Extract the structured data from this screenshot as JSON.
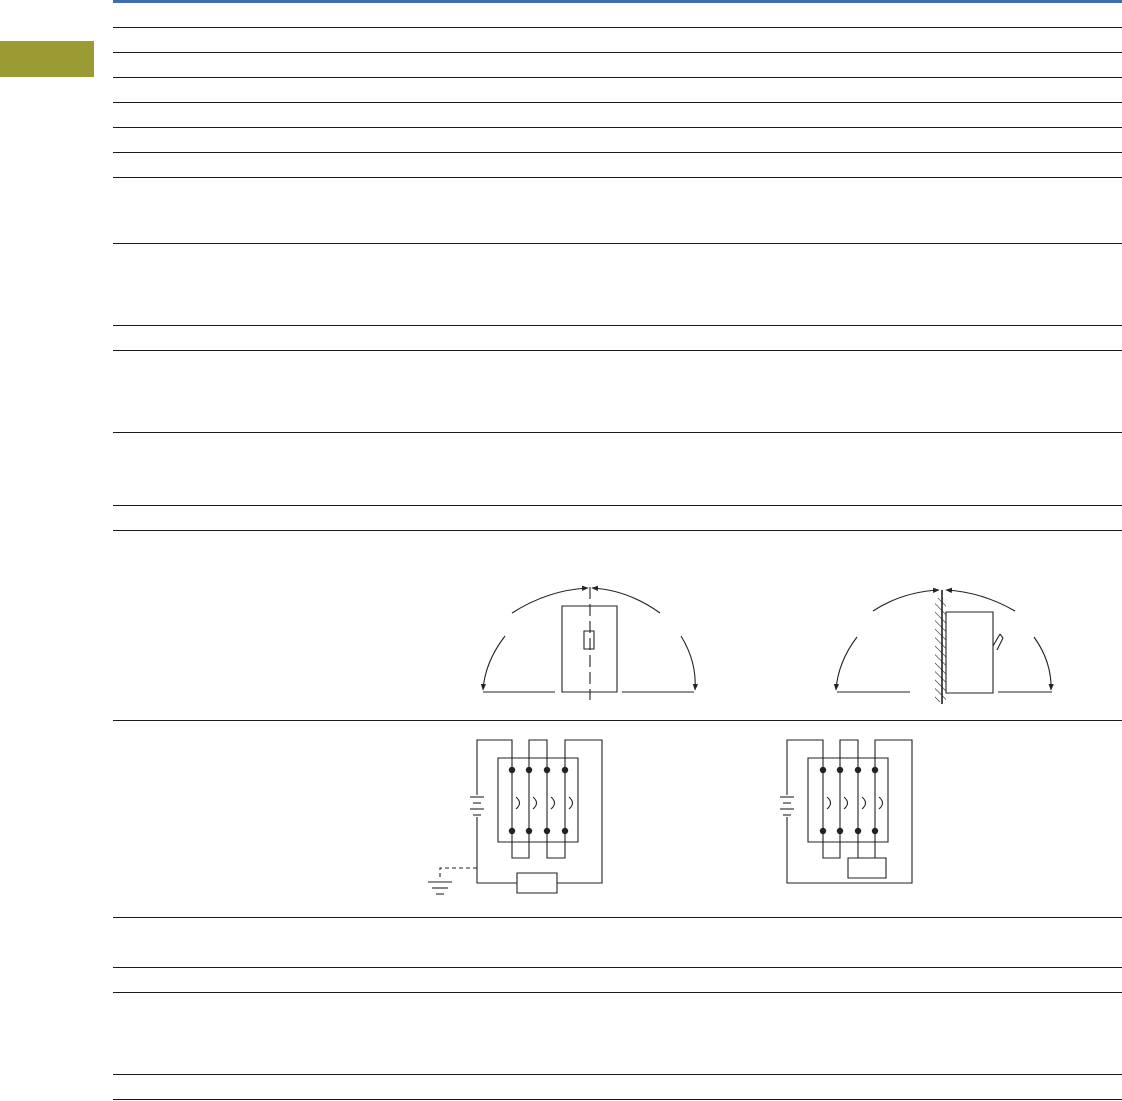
{
  "colors": {
    "accent_bar": "#3d6db5",
    "side_tab": "#9b9a33",
    "rule": "#1a1a1a",
    "line_art": "#222222"
  },
  "page": {
    "side_tab": {},
    "table_rows": 19
  },
  "figures": {
    "mounting_positions": [
      {
        "icon": "vertical-panel-mounting-angle-diagram"
      },
      {
        "icon": "wall-mounting-angle-diagram"
      }
    ],
    "wiring_diagrams": [
      {
        "icon": "four-pole-series-wiring-with-earth-diagram"
      },
      {
        "icon": "four-pole-series-wiring-diagram"
      }
    ]
  }
}
